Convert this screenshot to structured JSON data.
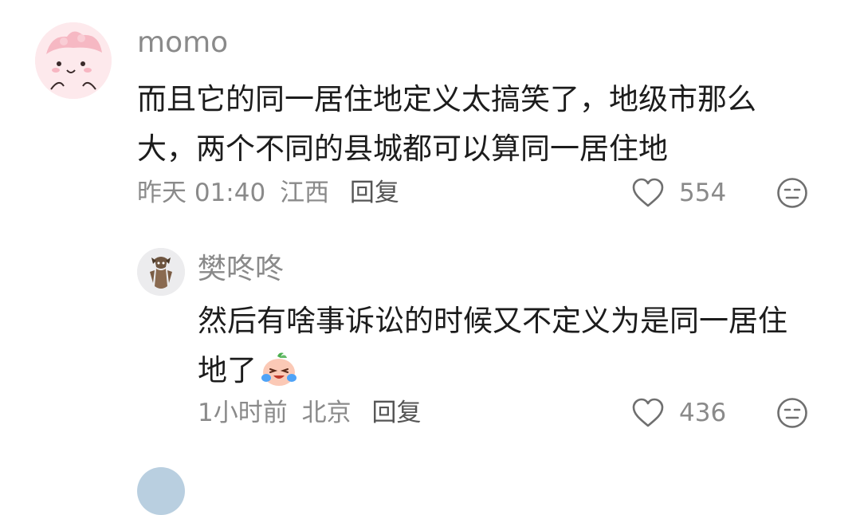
{
  "comments": [
    {
      "username": "momo",
      "text": "而且它的同一居住地定义太搞笑了，地级市那么大，两个不同的县城都可以算同一居住地",
      "time": "昨天 01:40",
      "location": "江西",
      "reply_label": "回复",
      "likes": "554",
      "avatar_icon": "pink-cartoon-avatar"
    }
  ],
  "replies": [
    {
      "username": "樊咚咚",
      "text": "然后有啥事诉讼的时候又不定义为是同一居住地了",
      "emoji": "crying-laughing-emoji",
      "time": "1小时前",
      "location": "北京",
      "reply_label": "回复",
      "likes": "436",
      "avatar_icon": "cartoon-dog-avatar"
    }
  ],
  "colors": {
    "text": "#1c1c1c",
    "secondary": "#8a8a8a",
    "icon": "#6f6f6f"
  }
}
